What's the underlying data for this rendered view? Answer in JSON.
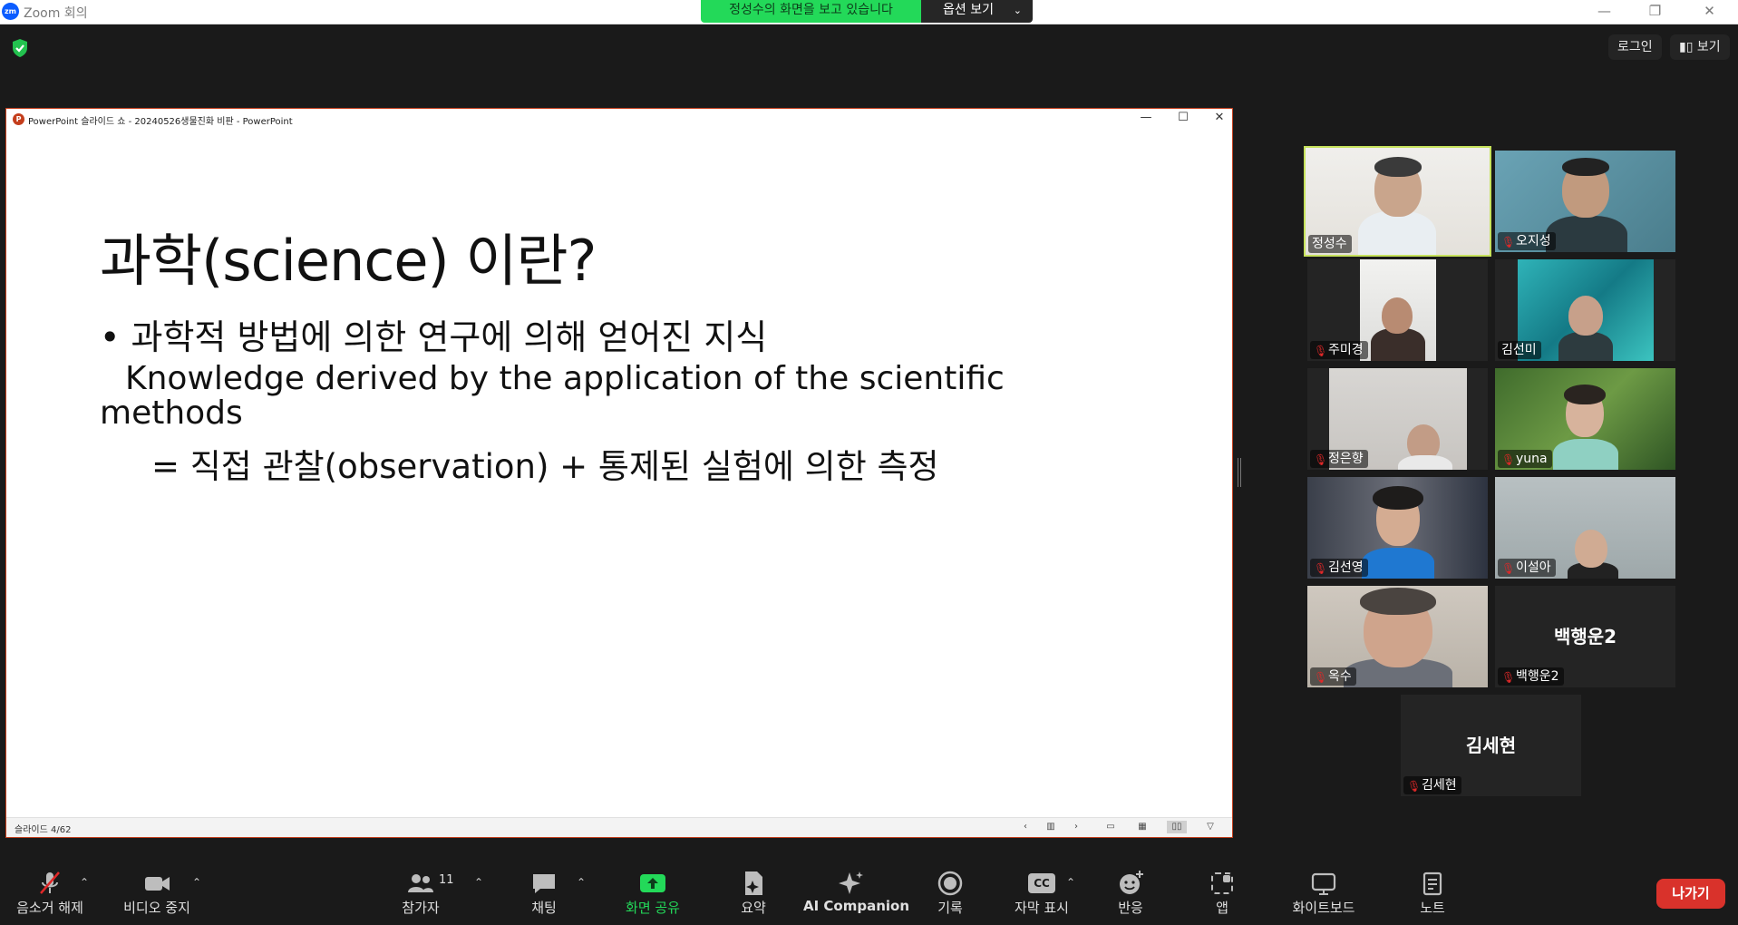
{
  "window": {
    "app_title": "Zoom 회의",
    "logo_text": "zm",
    "share_banner_text": "정성수의 화면을 보고 있습니다",
    "share_options_label": "옵션 보기",
    "controls": {
      "minimize": "—",
      "restore": "❐",
      "close": "✕"
    }
  },
  "top_right": {
    "login_label": "로그인",
    "view_label": "보기"
  },
  "powerpoint": {
    "title": "PowerPoint 슬라이드 쇼  -  20240526생물진화 비판 - PowerPoint",
    "icon_letter": "P",
    "slide_counter": "슬라이드 4/62",
    "slide": {
      "heading": "과학(science) 이란?",
      "bullet_ko": "• 과학적 방법에 의한 연구에 의해 얻어진 지식",
      "bullet_en_line1": "Knowledge derived by the application of the scientific",
      "bullet_en_line2": "methods",
      "equation": "= 직접 관찰(observation) + 통제된 실험에 의한 측정"
    }
  },
  "participants": [
    {
      "name": "정성수",
      "muted": false,
      "video": true,
      "speaking": true
    },
    {
      "name": "오지성",
      "muted": true,
      "video": true,
      "speaking": false
    },
    {
      "name": "주미경",
      "muted": true,
      "video": true,
      "speaking": false
    },
    {
      "name": "김선미",
      "muted": false,
      "video": true,
      "speaking": false
    },
    {
      "name": "정은향",
      "muted": true,
      "video": true,
      "speaking": false
    },
    {
      "name": "yuna",
      "muted": true,
      "video": true,
      "speaking": false
    },
    {
      "name": "김선영",
      "muted": true,
      "video": true,
      "speaking": false
    },
    {
      "name": "이설아",
      "muted": true,
      "video": true,
      "speaking": false
    },
    {
      "name": "옥수",
      "muted": true,
      "video": true,
      "speaking": false
    },
    {
      "name": "백행운2",
      "muted": true,
      "video": false,
      "speaking": false
    },
    {
      "name": "김세현",
      "muted": true,
      "video": false,
      "speaking": false
    }
  ],
  "toolbar": {
    "unmute": "음소거 해제",
    "stop_video": "비디오 중지",
    "participants": "참가자",
    "participant_count": "11",
    "chat": "채팅",
    "share_screen": "화면 공유",
    "summary": "요약",
    "ai_companion": "AI Companion",
    "record": "기록",
    "captions": "자막 표시",
    "cc_badge": "CC",
    "reactions": "반응",
    "apps": "앱",
    "whiteboard": "화이트보드",
    "notes": "노트",
    "leave": "나가기"
  },
  "colors": {
    "share_banner": "#23d959",
    "speaking_border": "#c6e25c",
    "leave": "#d9322b",
    "mute_icon": "#e02828",
    "ppt_accent": "#c43e1c"
  }
}
